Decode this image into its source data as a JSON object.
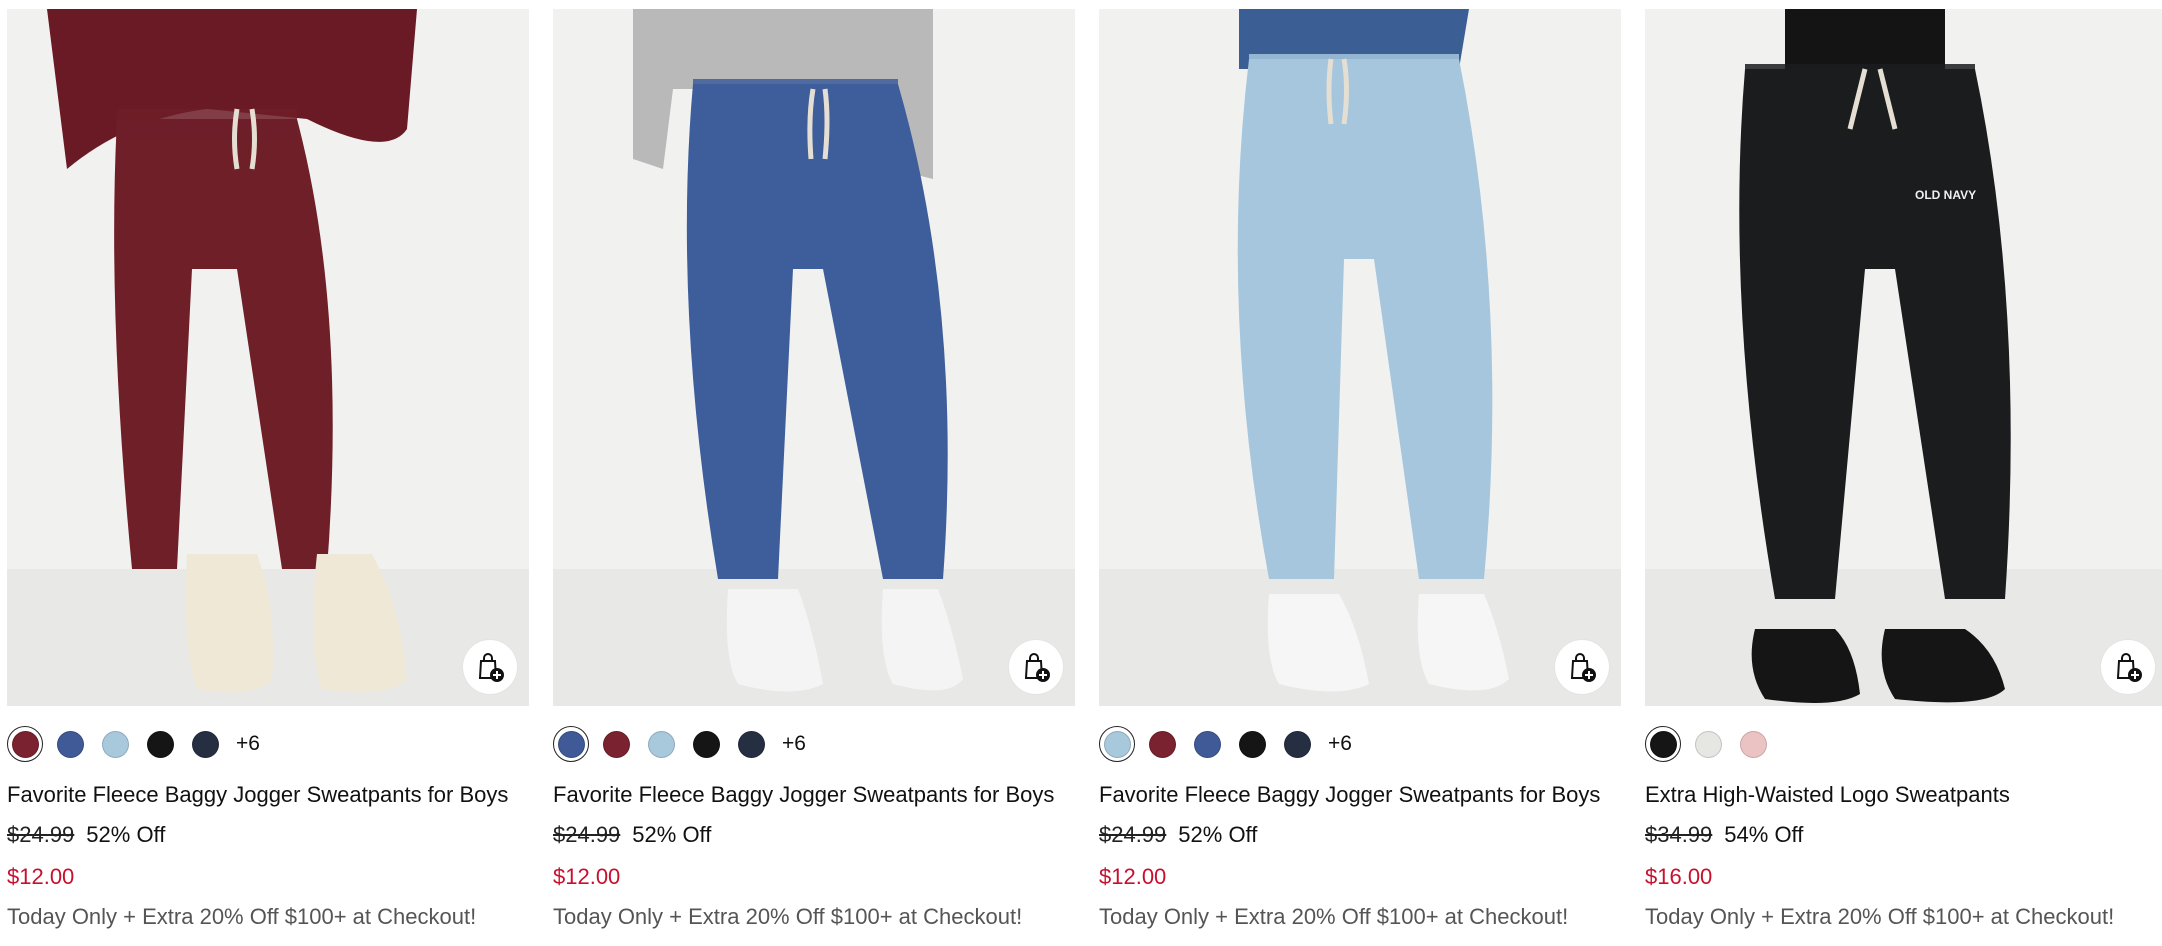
{
  "products": [
    {
      "name": "Favorite Fleece Baggy Jogger Sweatpants for Boys",
      "was_price": "$24.99",
      "discount": "52% Off",
      "sale_price": "$12.00",
      "promo": "Today Only + Extra 20% Off $100+ at Checkout!",
      "more_colors": "+6",
      "pant_color": "#6e1f28",
      "top_color": "#6a1a24",
      "shoe_color": "#efe8d6",
      "swatches": [
        "#7a2230",
        "#3f5a96",
        "#a8c8dc",
        "#151515",
        "#262f42"
      ],
      "selected_swatch": 0,
      "icon": "bag-plus-icon"
    },
    {
      "name": "Favorite Fleece Baggy Jogger Sweatpants for Boys",
      "was_price": "$24.99",
      "discount": "52% Off",
      "sale_price": "$12.00",
      "promo": "Today Only + Extra 20% Off $100+ at Checkout!",
      "more_colors": "+6",
      "pant_color": "#3d5d9b",
      "top_color": "#b9b9b9",
      "shoe_color": "#f4f4f4",
      "swatches": [
        "#3f5a96",
        "#7a2230",
        "#a8c8dc",
        "#151515",
        "#262f42"
      ],
      "selected_swatch": 0,
      "icon": "bag-plus-icon"
    },
    {
      "name": "Favorite Fleece Baggy Jogger Sweatpants for Boys",
      "was_price": "$24.99",
      "discount": "52% Off",
      "sale_price": "$12.00",
      "promo": "Today Only + Extra 20% Off $100+ at Checkout!",
      "more_colors": "+6",
      "pant_color": "#a5c6dc",
      "top_color": "#3b5f95",
      "shoe_color": "#f6f6f6",
      "swatches": [
        "#a8c8dc",
        "#7a2230",
        "#3f5a96",
        "#151515",
        "#262f42"
      ],
      "selected_swatch": 0,
      "icon": "bag-plus-icon"
    },
    {
      "name": "Extra High-Waisted Logo Sweatpants",
      "was_price": "$34.99",
      "discount": "54% Off",
      "sale_price": "$16.00",
      "promo": "Today Only + Extra 20% Off $100+ at Checkout!",
      "more_colors": "",
      "pant_color": "#1b1c1e",
      "top_color": "#141414",
      "shoe_color": "#151515",
      "logo_text": "OLD NAVY",
      "swatches": [
        "#151515",
        "#e6e6e3",
        "#ebc3c2"
      ],
      "selected_swatch": 0,
      "icon": "bag-plus-icon"
    }
  ]
}
